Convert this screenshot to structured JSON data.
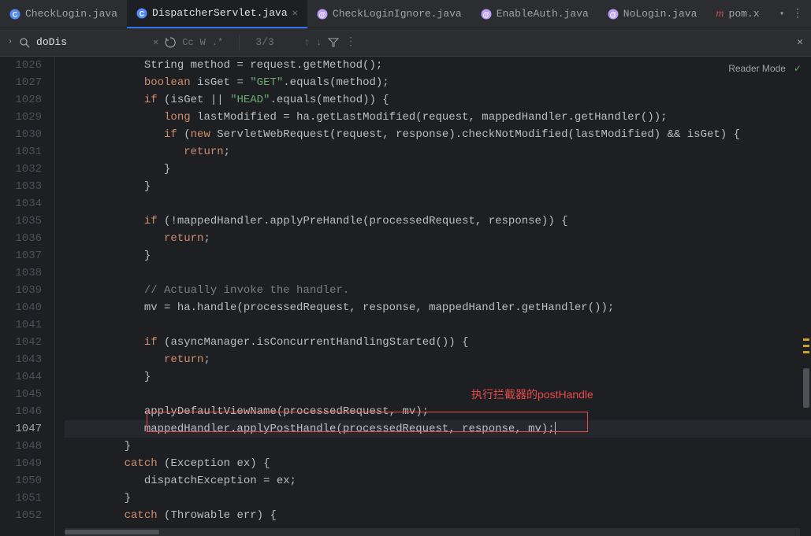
{
  "tabs": [
    {
      "label": "CheckLogin.java",
      "icon": "class",
      "active": false,
      "iconColor": "#548af7"
    },
    {
      "label": "DispatcherServlet.java",
      "icon": "class",
      "active": true,
      "iconColor": "#548af7"
    },
    {
      "label": "CheckLoginIgnore.java",
      "icon": "annotation",
      "active": false,
      "iconColor": "#b99bf8"
    },
    {
      "label": "EnableAuth.java",
      "icon": "annotation",
      "active": false,
      "iconColor": "#b99bf8"
    },
    {
      "label": "NoLogin.java",
      "icon": "annotation",
      "active": false,
      "iconColor": "#b99bf8"
    },
    {
      "label": "pom.x",
      "icon": "maven",
      "active": false,
      "iconColor": "#ce4f4f"
    }
  ],
  "search": {
    "value": "doDis",
    "options": [
      "Cc",
      "W",
      ".*"
    ],
    "count": "3/3"
  },
  "reader_mode": "Reader Mode",
  "annotation_text": "执行拦截器的postHandle",
  "line_start": 1026,
  "highlight_line": 1047,
  "code_lines": [
    [
      {
        "t": "            String method = request.getMethod();"
      }
    ],
    [
      {
        "t": "            ",
        "c": ""
      },
      {
        "t": "boolean",
        "c": "kw"
      },
      {
        "t": " isGet = "
      },
      {
        "t": "\"GET\"",
        "c": "str"
      },
      {
        "t": ".equals(method);"
      }
    ],
    [
      {
        "t": "            ",
        "c": ""
      },
      {
        "t": "if",
        "c": "kw"
      },
      {
        "t": " (isGet || "
      },
      {
        "t": "\"HEAD\"",
        "c": "str"
      },
      {
        "t": ".equals(method)) {"
      }
    ],
    [
      {
        "t": "               ",
        "c": ""
      },
      {
        "t": "long",
        "c": "kw"
      },
      {
        "t": " lastModified = ha.getLastModified(request, mappedHandler.getHandler());"
      }
    ],
    [
      {
        "t": "               ",
        "c": ""
      },
      {
        "t": "if",
        "c": "kw"
      },
      {
        "t": " ("
      },
      {
        "t": "new",
        "c": "kw"
      },
      {
        "t": " ServletWebRequest(request, response).checkNotModified(lastModified) && isGet) {"
      }
    ],
    [
      {
        "t": "                  ",
        "c": ""
      },
      {
        "t": "return",
        "c": "kw"
      },
      {
        "t": ";"
      }
    ],
    [
      {
        "t": "               }"
      }
    ],
    [
      {
        "t": "            }"
      }
    ],
    [
      {
        "t": ""
      }
    ],
    [
      {
        "t": "            ",
        "c": ""
      },
      {
        "t": "if",
        "c": "kw"
      },
      {
        "t": " (!mappedHandler.applyPreHandle(processedRequest, response)) {"
      }
    ],
    [
      {
        "t": "               ",
        "c": ""
      },
      {
        "t": "return",
        "c": "kw"
      },
      {
        "t": ";"
      }
    ],
    [
      {
        "t": "            }"
      }
    ],
    [
      {
        "t": ""
      }
    ],
    [
      {
        "t": "            ",
        "c": ""
      },
      {
        "t": "// Actually invoke the handler.",
        "c": "cmt"
      }
    ],
    [
      {
        "t": "            mv = ha.handle(processedRequest, response, mappedHandler.getHandler());"
      }
    ],
    [
      {
        "t": ""
      }
    ],
    [
      {
        "t": "            ",
        "c": ""
      },
      {
        "t": "if",
        "c": "kw"
      },
      {
        "t": " (asyncManager.isConcurrentHandlingStarted()) {"
      }
    ],
    [
      {
        "t": "               ",
        "c": ""
      },
      {
        "t": "return",
        "c": "kw"
      },
      {
        "t": ";"
      }
    ],
    [
      {
        "t": "            }"
      }
    ],
    [
      {
        "t": ""
      }
    ],
    [
      {
        "t": "            applyDefaultViewName(processedRequest, mv);"
      }
    ],
    [
      {
        "t": "            mappedHandler.applyPostHandle(processedRequest, response, mv);"
      }
    ],
    [
      {
        "t": "         }"
      }
    ],
    [
      {
        "t": "         ",
        "c": ""
      },
      {
        "t": "catch",
        "c": "kw"
      },
      {
        "t": " (Exception ex) {"
      }
    ],
    [
      {
        "t": "            dispatchException = ex;"
      }
    ],
    [
      {
        "t": "         }"
      }
    ],
    [
      {
        "t": "         ",
        "c": ""
      },
      {
        "t": "catch",
        "c": "kw"
      },
      {
        "t": " (Throwable err) {"
      }
    ]
  ]
}
